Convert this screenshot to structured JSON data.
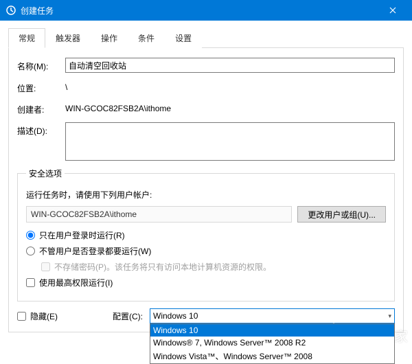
{
  "window": {
    "title": "创建任务"
  },
  "tabs": [
    "常规",
    "触发器",
    "操作",
    "条件",
    "设置"
  ],
  "general": {
    "name_label": "名称(M):",
    "name_value": "自动清空回收站",
    "location_label": "位置:",
    "location_value": "\\",
    "author_label": "创建者:",
    "author_value": "WIN-GCOC82FSB2A\\ithome",
    "description_label": "描述(D):",
    "description_value": ""
  },
  "security": {
    "legend": "安全选项",
    "run_as_text": "运行任务时，请使用下列用户帐户:",
    "account": "WIN-GCOC82FSB2A\\ithome",
    "change_user_btn": "更改用户或组(U)...",
    "radio_logged_on": "只在用户登录时运行(R)",
    "radio_any": "不管用户是否登录都要运行(W)",
    "no_password": "不存储密码(P)。该任务将只有访问本地计算机资源的权限。",
    "highest_priv": "使用最高权限运行(I)"
  },
  "bottom": {
    "hidden_label": "隐藏(E)",
    "config_label": "配置(C):",
    "config_value": "Windows 10",
    "config_options": [
      "Windows 10",
      "Windows® 7, Windows Server™ 2008 R2",
      "Windows Vista™、Windows Server™ 2008"
    ]
  },
  "watermark": "系统之家"
}
